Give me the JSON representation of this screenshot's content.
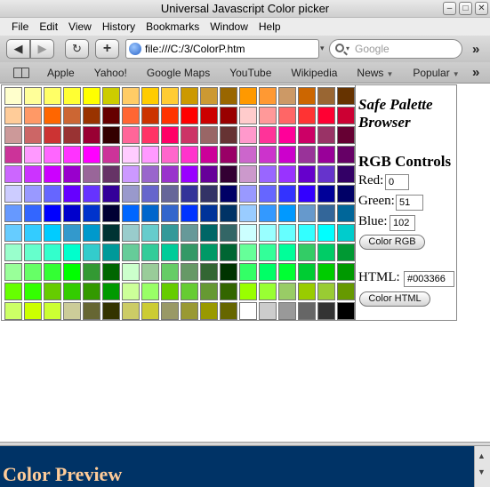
{
  "window": {
    "title": "Universal Javascript Color picker",
    "btn_min": "–",
    "btn_max": "□",
    "btn_close": "✕"
  },
  "menu": [
    "File",
    "Edit",
    "View",
    "History",
    "Bookmarks",
    "Window",
    "Help"
  ],
  "toolbar": {
    "back": "◀",
    "forward": "▶",
    "reload": "↻",
    "add": "+",
    "url": "file:///C:/3/ColorP.htm",
    "search_placeholder": "Google",
    "overflow": "»"
  },
  "bookmarks": {
    "items": [
      {
        "label": "Apple",
        "dropdown": false
      },
      {
        "label": "Yahoo!",
        "dropdown": false
      },
      {
        "label": "Google Maps",
        "dropdown": false
      },
      {
        "label": "YouTube",
        "dropdown": false
      },
      {
        "label": "Wikipedia",
        "dropdown": false
      },
      {
        "label": "News",
        "dropdown": true
      },
      {
        "label": "Popular",
        "dropdown": true
      }
    ],
    "overflow": "»"
  },
  "palette": {
    "rows": [
      [
        "#ffffcc",
        "#ffff99",
        "#ffff66",
        "#ffff33",
        "#ffff00",
        "#cccc00",
        "#ffcc66",
        "#ffcc00",
        "#ffcc33",
        "#cc9900",
        "#cc9933",
        "#996600",
        "#ff9900",
        "#ff9933",
        "#cc9966",
        "#cc6600",
        "#996633",
        "#663300"
      ],
      [
        "#ffcc99",
        "#ff9966",
        "#ff6600",
        "#cc6633",
        "#993300",
        "#660000",
        "#ff6633",
        "#cc3300",
        "#ff3300",
        "#ff0000",
        "#cc0000",
        "#990000",
        "#ffcccc",
        "#ff9999",
        "#ff6666",
        "#ff3333",
        "#ff0033",
        "#cc0033"
      ],
      [
        "#cc9999",
        "#cc6666",
        "#cc3333",
        "#993333",
        "#990033",
        "#330000",
        "#ff6699",
        "#ff3366",
        "#ff0066",
        "#cc3366",
        "#996666",
        "#663333",
        "#ff99cc",
        "#ff3399",
        "#ff0099",
        "#cc0066",
        "#993366",
        "#660033"
      ],
      [
        "#cc3399",
        "#ff99ff",
        "#ff66ff",
        "#ff33ff",
        "#ff00ff",
        "#cc3399",
        "#ffccff",
        "#ff99ff",
        "#ff66cc",
        "#ff33cc",
        "#cc0099",
        "#990066",
        "#cc66cc",
        "#cc33cc",
        "#cc00cc",
        "#993399",
        "#990099",
        "#660066"
      ],
      [
        "#cc66ff",
        "#cc33ff",
        "#cc00ff",
        "#9900cc",
        "#996699",
        "#663366",
        "#cc99ff",
        "#9966cc",
        "#9933cc",
        "#9900ff",
        "#660099",
        "#330033",
        "#cc99cc",
        "#9966ff",
        "#9933ff",
        "#6600cc",
        "#6633cc",
        "#330066"
      ],
      [
        "#ccccff",
        "#9999ff",
        "#6666ff",
        "#6600ff",
        "#6633ff",
        "#330099",
        "#9999cc",
        "#6666cc",
        "#666699",
        "#333399",
        "#333366",
        "#000066",
        "#9999ff",
        "#6666ff",
        "#3333ff",
        "#3300ff",
        "#000099",
        "#000066"
      ],
      [
        "#6699ff",
        "#3366ff",
        "#0000ff",
        "#0000cc",
        "#0033cc",
        "#000033",
        "#0066ff",
        "#0066cc",
        "#3366cc",
        "#0033ff",
        "#003399",
        "#003366",
        "#99ccff",
        "#3399ff",
        "#0099ff",
        "#6699cc",
        "#336699",
        "#006699"
      ],
      [
        "#66ccff",
        "#33ccff",
        "#00ccff",
        "#3399cc",
        "#0099cc",
        "#003333",
        "#99cccc",
        "#66cccc",
        "#339999",
        "#669999",
        "#006666",
        "#336666",
        "#ccffff",
        "#99ffff",
        "#66ffff",
        "#33ffff",
        "#00ffff",
        "#00cccc"
      ],
      [
        "#99ffcc",
        "#66ffcc",
        "#33ffcc",
        "#00ffcc",
        "#33cccc",
        "#009999",
        "#66cc99",
        "#33cc99",
        "#00cc99",
        "#339966",
        "#009966",
        "#006633",
        "#66ff99",
        "#33ff99",
        "#00ff99",
        "#33cc66",
        "#00cc66",
        "#009933"
      ],
      [
        "#99ff99",
        "#66ff66",
        "#33ff33",
        "#00ff00",
        "#339933",
        "#006600",
        "#ccffcc",
        "#99cc99",
        "#66cc66",
        "#669966",
        "#336633",
        "#003300",
        "#33ff66",
        "#00ff66",
        "#00ff33",
        "#00cc33",
        "#00cc00",
        "#009900"
      ],
      [
        "#66ff00",
        "#33ff00",
        "#66cc00",
        "#33cc00",
        "#339900",
        "#009900",
        "#ccff99",
        "#99ff66",
        "#66cc00",
        "#66cc33",
        "#669933",
        "#336600",
        "#99ff00",
        "#99ff33",
        "#99cc66",
        "#99cc00",
        "#99cc33",
        "#669900"
      ],
      [
        "#ccff66",
        "#ccff00",
        "#ccff33",
        "#cccc99",
        "#666633",
        "#333300",
        "#cccc66",
        "#cccc33",
        "#999966",
        "#999933",
        "#999900",
        "#666600",
        "#ffffff",
        "#cccccc",
        "#999999",
        "#666666",
        "#333333",
        "#000000"
      ]
    ]
  },
  "controls": {
    "safe_title": "Safe Palette Browser",
    "rgb_title": "RGB Controls",
    "red_label": "Red:",
    "red_value": "0",
    "green_label": "Green:",
    "green_value": "51",
    "blue_label": "Blue:",
    "blue_value": "102",
    "color_rgb_button": "Color RGB",
    "html_label": "HTML:",
    "html_value": "#003366",
    "color_html_button": "Color HTML"
  },
  "preview": {
    "text": "Color Preview",
    "bg_color": "#003366",
    "text_color": "#ffcc99"
  },
  "scroll": {
    "up": "▲",
    "down": "▼"
  }
}
